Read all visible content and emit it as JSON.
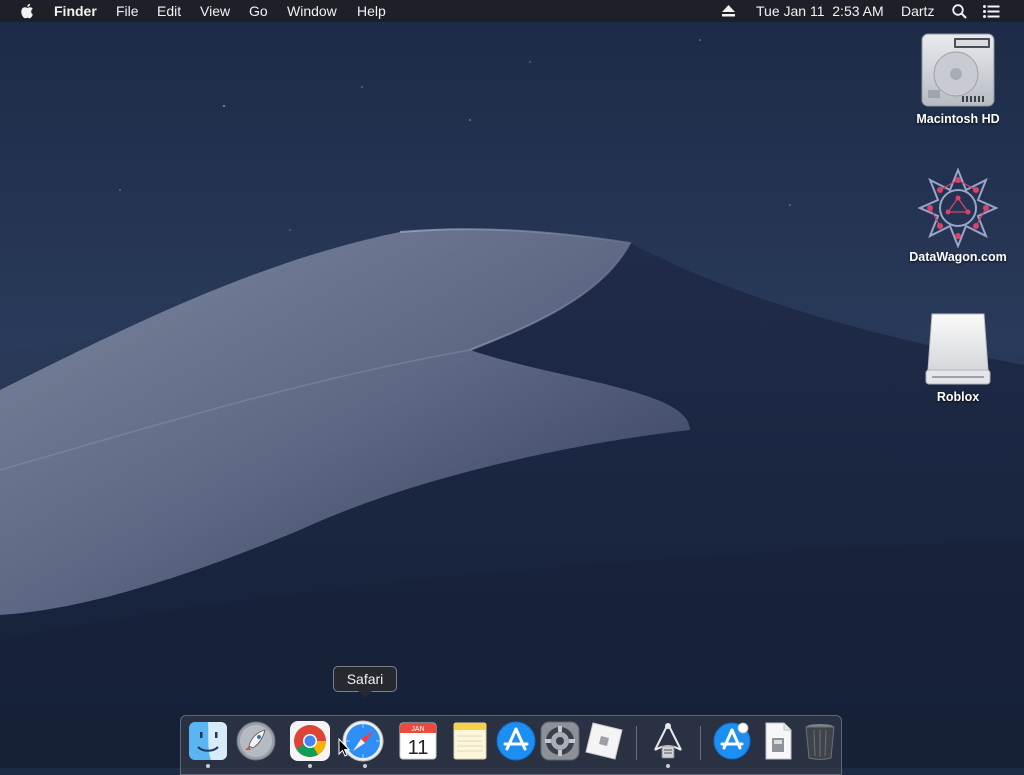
{
  "menubar": {
    "apple_icon": "apple-logo-icon",
    "app_name": "Finder",
    "menus": [
      "File",
      "Edit",
      "View",
      "Go",
      "Window",
      "Help"
    ],
    "eject_icon": "eject-icon",
    "datetime": "Tue Jan 11  2:53 AM",
    "user": "Dartz",
    "spotlight_icon": "magnifier-icon",
    "notification_icon": "list-icon"
  },
  "desktop": {
    "icons": [
      {
        "label": "Macintosh HD",
        "icon": "hard-drive-icon"
      },
      {
        "label": "DataWagon.com",
        "icon": "datawagon-icon"
      },
      {
        "label": "Roblox",
        "icon": "external-drive-icon"
      }
    ]
  },
  "dock": {
    "tooltip": "Safari",
    "apps": [
      {
        "name": "Finder",
        "icon": "finder-icon",
        "running": true
      },
      {
        "name": "Launchpad",
        "icon": "rocket-icon",
        "running": false
      },
      {
        "name": "Chrome",
        "icon": "chrome-icon",
        "running": true
      },
      {
        "name": "Safari",
        "icon": "compass-icon",
        "running": true
      },
      {
        "name": "Calendar",
        "icon": "calendar-icon",
        "running": false,
        "month": "JAN",
        "day": "11"
      },
      {
        "name": "Notes",
        "icon": "notes-icon",
        "running": false
      },
      {
        "name": "App Store",
        "icon": "app-store-icon",
        "running": false
      },
      {
        "name": "System Preferences",
        "icon": "gear-icon",
        "running": false
      },
      {
        "name": "Roblox",
        "icon": "roblox-icon",
        "running": false
      },
      {
        "name": "Utility",
        "icon": "network-icon",
        "running": true
      },
      {
        "name": "App Store Downloads",
        "icon": "app-store-folder-icon",
        "running": false
      },
      {
        "name": "Document",
        "icon": "document-icon",
        "running": false
      },
      {
        "name": "Trash",
        "icon": "trash-icon",
        "running": false
      }
    ]
  },
  "colors": {
    "menubar": "#1e2026",
    "sky_top": "#20304d",
    "sky_bottom": "#2c3c5c",
    "dune_light": "#8b93a8",
    "dune_dark": "#1a2440"
  }
}
